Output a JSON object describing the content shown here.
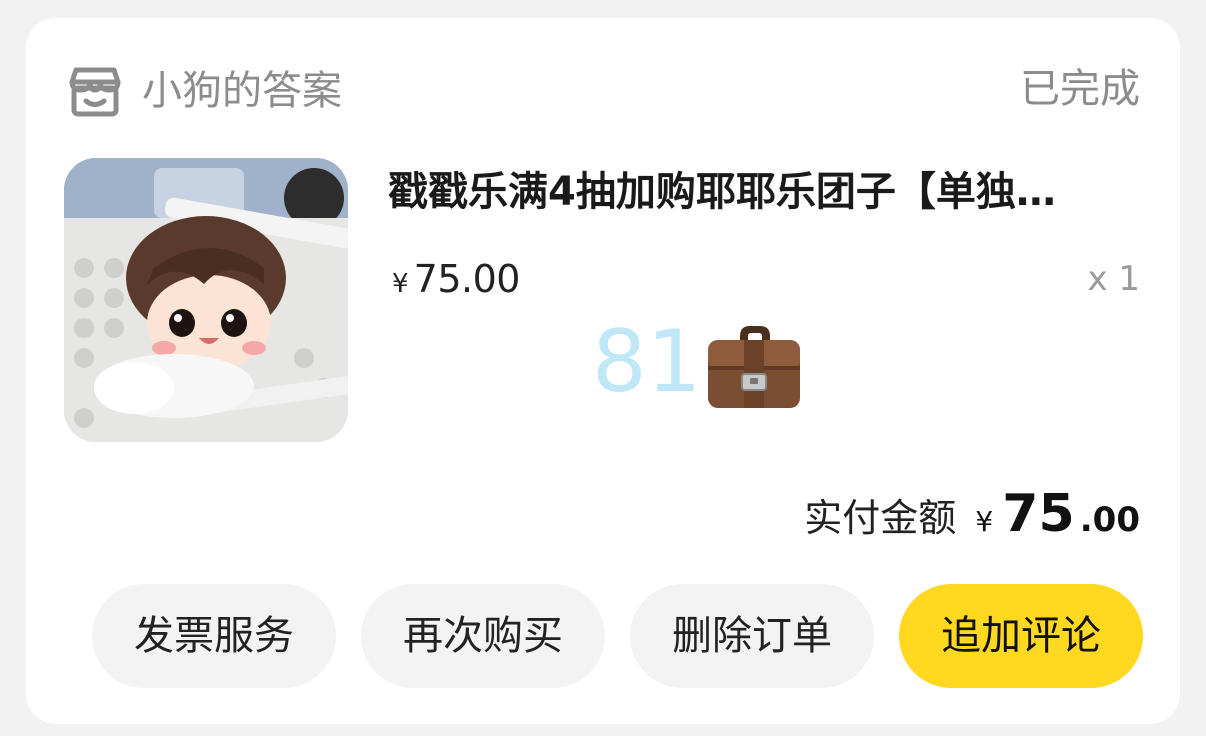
{
  "order": {
    "shop_name": "小狗的答案",
    "status": "已完成",
    "item": {
      "title": "戳戳乐满4抽加购耶耶乐团子【单独…",
      "currency": "¥",
      "price": "75.00",
      "quantity": "x 1"
    },
    "overlay": {
      "number": "81",
      "icon": "briefcase-icon"
    },
    "total": {
      "label": "实付金额",
      "currency": "¥",
      "integer": "75",
      "decimal": ".00"
    }
  },
  "actions": {
    "invoice_label": "发票服务",
    "rebuy_label": "再次购买",
    "delete_label": "删除订单",
    "review_label": "追加评论"
  },
  "colors": {
    "primary_button": "#ffd81f",
    "secondary_button": "#f3f3f3",
    "muted_text": "#8c8c8c",
    "overlay_number": "#bfe7f7"
  }
}
